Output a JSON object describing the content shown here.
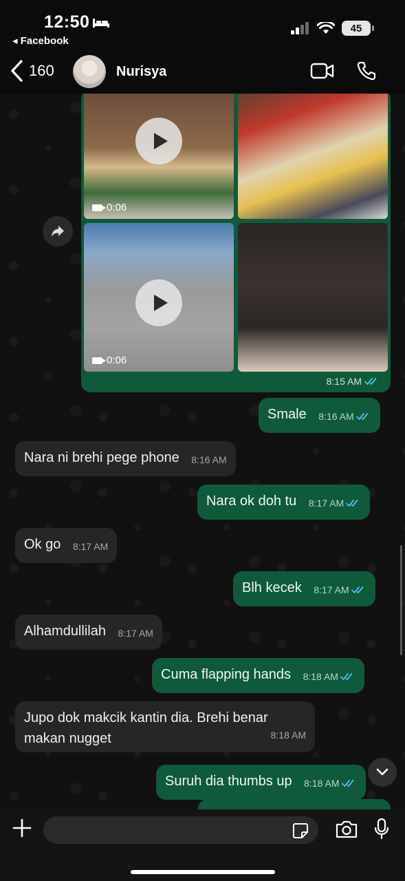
{
  "status": {
    "time": "12:50",
    "back_app": "◂ Facebook",
    "battery": "45"
  },
  "header": {
    "back_count": "160",
    "contact_name": "Nurisya"
  },
  "media": {
    "video1_duration": "0:06",
    "video2_duration": "0:06",
    "time": "8:15 AM"
  },
  "messages": [
    {
      "dir": "out",
      "text": "Smale",
      "time": "8:16 AM"
    },
    {
      "dir": "in",
      "text": "Nara ni brehi pege phone",
      "time": "8:16 AM"
    },
    {
      "dir": "out",
      "text": "Nara ok doh tu",
      "time": "8:17 AM"
    },
    {
      "dir": "in",
      "text": "Ok go",
      "time": "8:17 AM"
    },
    {
      "dir": "out",
      "text": "Blh kecek",
      "time": "8:17 AM"
    },
    {
      "dir": "in",
      "text": "Alhamdullilah",
      "time": "8:17 AM"
    },
    {
      "dir": "out",
      "text": "Cuma flapping hands",
      "time": "8:18 AM"
    },
    {
      "dir": "in",
      "text_line1": "Jupo dok makcik kantin dia. Brehi benar",
      "text_line2": "makan nugget",
      "time": "8:18 AM"
    },
    {
      "dir": "out",
      "text": "Suruh dia thumbs up",
      "time": "8:18 AM"
    }
  ],
  "composer": {
    "placeholder": ""
  },
  "colors": {
    "outgoing": "#0f5a3b",
    "incoming": "#262626",
    "read_ticks": "#53bdeb"
  },
  "icons": [
    "bed-icon",
    "signal-icon",
    "wifi-icon",
    "battery-icon",
    "chevron-left-icon",
    "video-call-icon",
    "phone-icon",
    "play-icon",
    "video-camera-icon",
    "forward-icon",
    "double-check-icon",
    "chevron-down-icon",
    "plus-icon",
    "sticker-icon",
    "camera-icon",
    "microphone-icon"
  ]
}
